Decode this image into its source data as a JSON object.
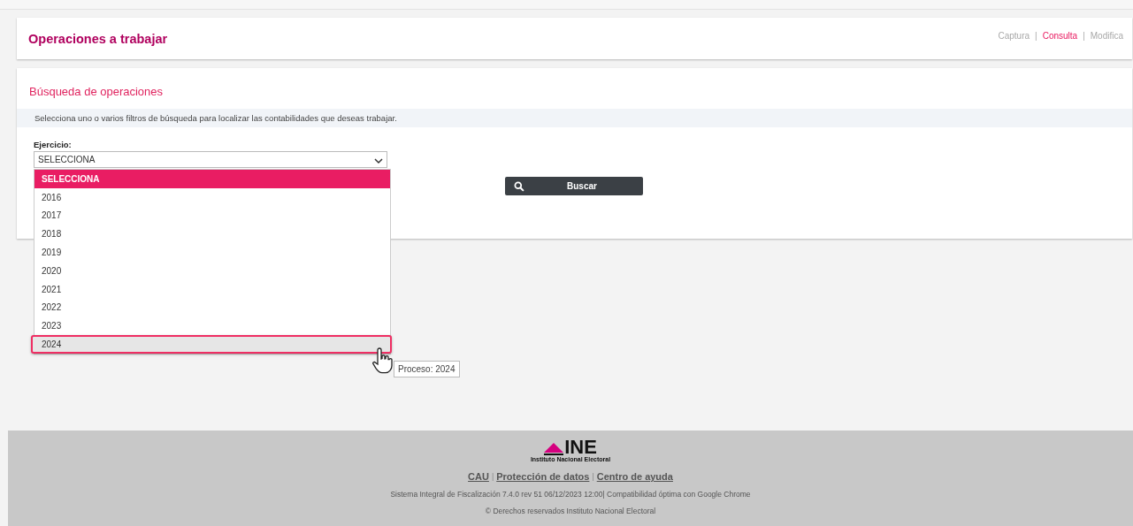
{
  "header": {
    "title": "Operaciones a trabajar",
    "separator": "|",
    "nav": [
      {
        "label": "Captura",
        "selected": false
      },
      {
        "label": "Consulta",
        "selected": true
      },
      {
        "label": "Modifica",
        "selected": false
      }
    ]
  },
  "search": {
    "title": "Búsqueda de operaciones",
    "instructions": "Selecciona uno o varios filtros de búsqueda para localizar las contabilidades que deseas trabajar.",
    "field_label": "Ejercicio:",
    "value": "SELECCIONA",
    "options": [
      {
        "label": "SELECCIONA",
        "selected": true,
        "hovered": false
      },
      {
        "label": "2016",
        "selected": false,
        "hovered": false
      },
      {
        "label": "2017",
        "selected": false,
        "hovered": false
      },
      {
        "label": "2018",
        "selected": false,
        "hovered": false
      },
      {
        "label": "2019",
        "selected": false,
        "hovered": false
      },
      {
        "label": "2020",
        "selected": false,
        "hovered": false
      },
      {
        "label": "2021",
        "selected": false,
        "hovered": false
      },
      {
        "label": "2022",
        "selected": false,
        "hovered": false
      },
      {
        "label": "2023",
        "selected": false,
        "hovered": false
      },
      {
        "label": "2024",
        "selected": false,
        "hovered": true
      }
    ],
    "tooltip": "Proceso: 2024",
    "button": "Buscar"
  },
  "footer": {
    "separator": "|",
    "logo_text": "INE",
    "logo_subtitle": "Instituto Nacional Electoral",
    "links": [
      "CAU",
      "Protección de datos",
      "Centro de ayuda"
    ],
    "version": "Sistema Integral de Fiscalización 7.4.0 rev 51 06/12/2023 12:00| Compatibilidad óptima con Google Chrome",
    "copyright": "© Derechos reservados Instituto Nacional Electoral"
  }
}
